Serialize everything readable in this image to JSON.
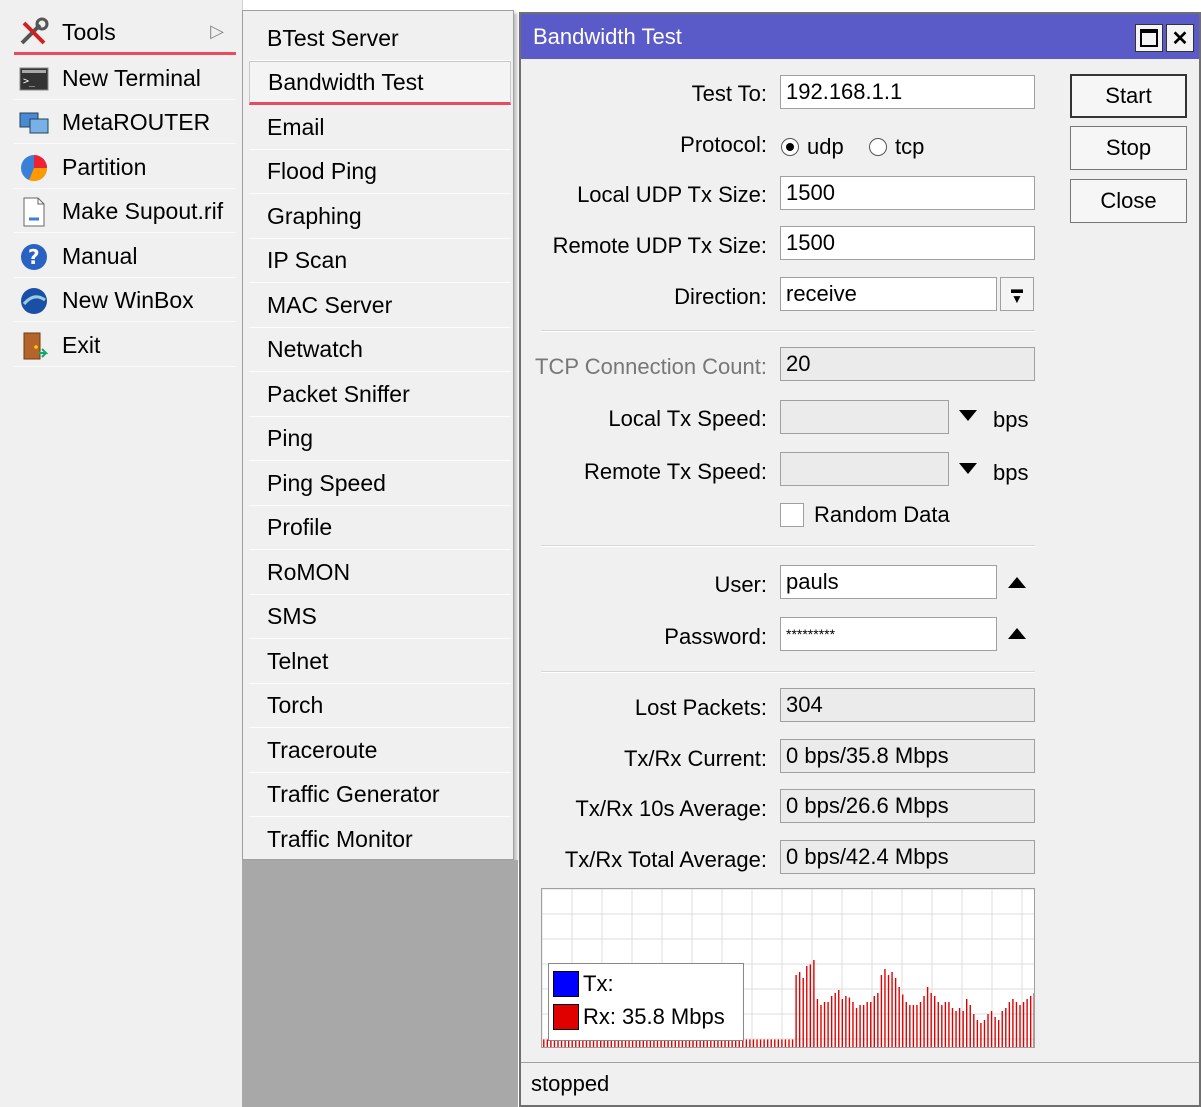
{
  "left_menu": {
    "items": [
      {
        "label": "Tools",
        "icon": "tools-icon"
      },
      {
        "label": "New Terminal",
        "icon": "terminal-icon"
      },
      {
        "label": "MetaROUTER",
        "icon": "metarouter-icon"
      },
      {
        "label": "Partition",
        "icon": "partition-icon"
      },
      {
        "label": "Make Supout.rif",
        "icon": "document-icon"
      },
      {
        "label": "Manual",
        "icon": "help-icon"
      },
      {
        "label": "New WinBox",
        "icon": "winbox-icon"
      },
      {
        "label": "Exit",
        "icon": "exit-icon"
      }
    ]
  },
  "submenu": {
    "items": [
      "BTest Server",
      "Bandwidth Test",
      "Email",
      "Flood Ping",
      "Graphing",
      "IP Scan",
      "MAC Server",
      "Netwatch",
      "Packet Sniffer",
      "Ping",
      "Ping Speed",
      "Profile",
      "RoMON",
      "SMS",
      "Telnet",
      "Torch",
      "Traceroute",
      "Traffic Generator",
      "Traffic Monitor"
    ]
  },
  "window": {
    "title": "Bandwidth Test",
    "buttons": {
      "start": "Start",
      "stop": "Stop",
      "close": "Close"
    },
    "labels": {
      "test_to": "Test To:",
      "protocol": "Protocol:",
      "local_udp": "Local UDP Tx Size:",
      "remote_udp": "Remote UDP Tx Size:",
      "direction": "Direction:",
      "tcp_count": "TCP Connection Count:",
      "local_speed": "Local Tx Speed:",
      "remote_speed": "Remote Tx Speed:",
      "user": "User:",
      "password": "Password:",
      "lost": "Lost Packets:",
      "current": "Tx/Rx Current:",
      "avg10": "Tx/Rx 10s Average:",
      "total": "Tx/Rx Total Average:"
    },
    "values": {
      "test_to": "192.168.1.1",
      "protocol_udp": "udp",
      "protocol_tcp": "tcp",
      "protocol_selected": "udp",
      "local_udp": "1500",
      "remote_udp": "1500",
      "direction": "receive",
      "tcp_count": "20",
      "local_speed": "",
      "remote_speed": "",
      "speed_unit": "bps",
      "random_data": "Random Data",
      "random_data_checked": false,
      "user": "pauls",
      "password": "*********",
      "lost": "304",
      "current": "0 bps/35.8 Mbps",
      "avg10": "0 bps/26.6 Mbps",
      "total": "0 bps/42.4 Mbps"
    },
    "legend": {
      "tx_label": "Tx:",
      "tx_value": "",
      "rx_label": "Rx:",
      "rx_value": "35.8 Mbps",
      "tx_color": "#0000ff",
      "rx_color": "#e00000"
    },
    "status": "stopped"
  },
  "chart_data": {
    "type": "bar",
    "series": [
      {
        "name": "Rx",
        "values": [
          5,
          5,
          5,
          5,
          5,
          5,
          5,
          5,
          5,
          5,
          5,
          5,
          5,
          5,
          5,
          5,
          5,
          5,
          5,
          5,
          5,
          5,
          5,
          5,
          5,
          5,
          5,
          5,
          5,
          5,
          5,
          5,
          5,
          5,
          5,
          5,
          5,
          5,
          5,
          5,
          5,
          5,
          5,
          5,
          5,
          5,
          5,
          5,
          5,
          5,
          5,
          5,
          5,
          5,
          5,
          5,
          5,
          5,
          5,
          5,
          5,
          5,
          5,
          5,
          5,
          5,
          5,
          5,
          5,
          5,
          5,
          48,
          50,
          46,
          54,
          55,
          58,
          32,
          28,
          30,
          30,
          34,
          36,
          38,
          32,
          34,
          33,
          30,
          26,
          28,
          28,
          30,
          30,
          34,
          36,
          48,
          52,
          48,
          50,
          46,
          40,
          35,
          30,
          28,
          28,
          28,
          30,
          34,
          40,
          36,
          34,
          30,
          28,
          30,
          30,
          26,
          24,
          26,
          24,
          32,
          28,
          22,
          18,
          16,
          18,
          22,
          24,
          20,
          18,
          24,
          26,
          30,
          32,
          30,
          28,
          30,
          32,
          34,
          36
        ]
      },
      {
        "name": "Tx",
        "values": []
      }
    ]
  }
}
